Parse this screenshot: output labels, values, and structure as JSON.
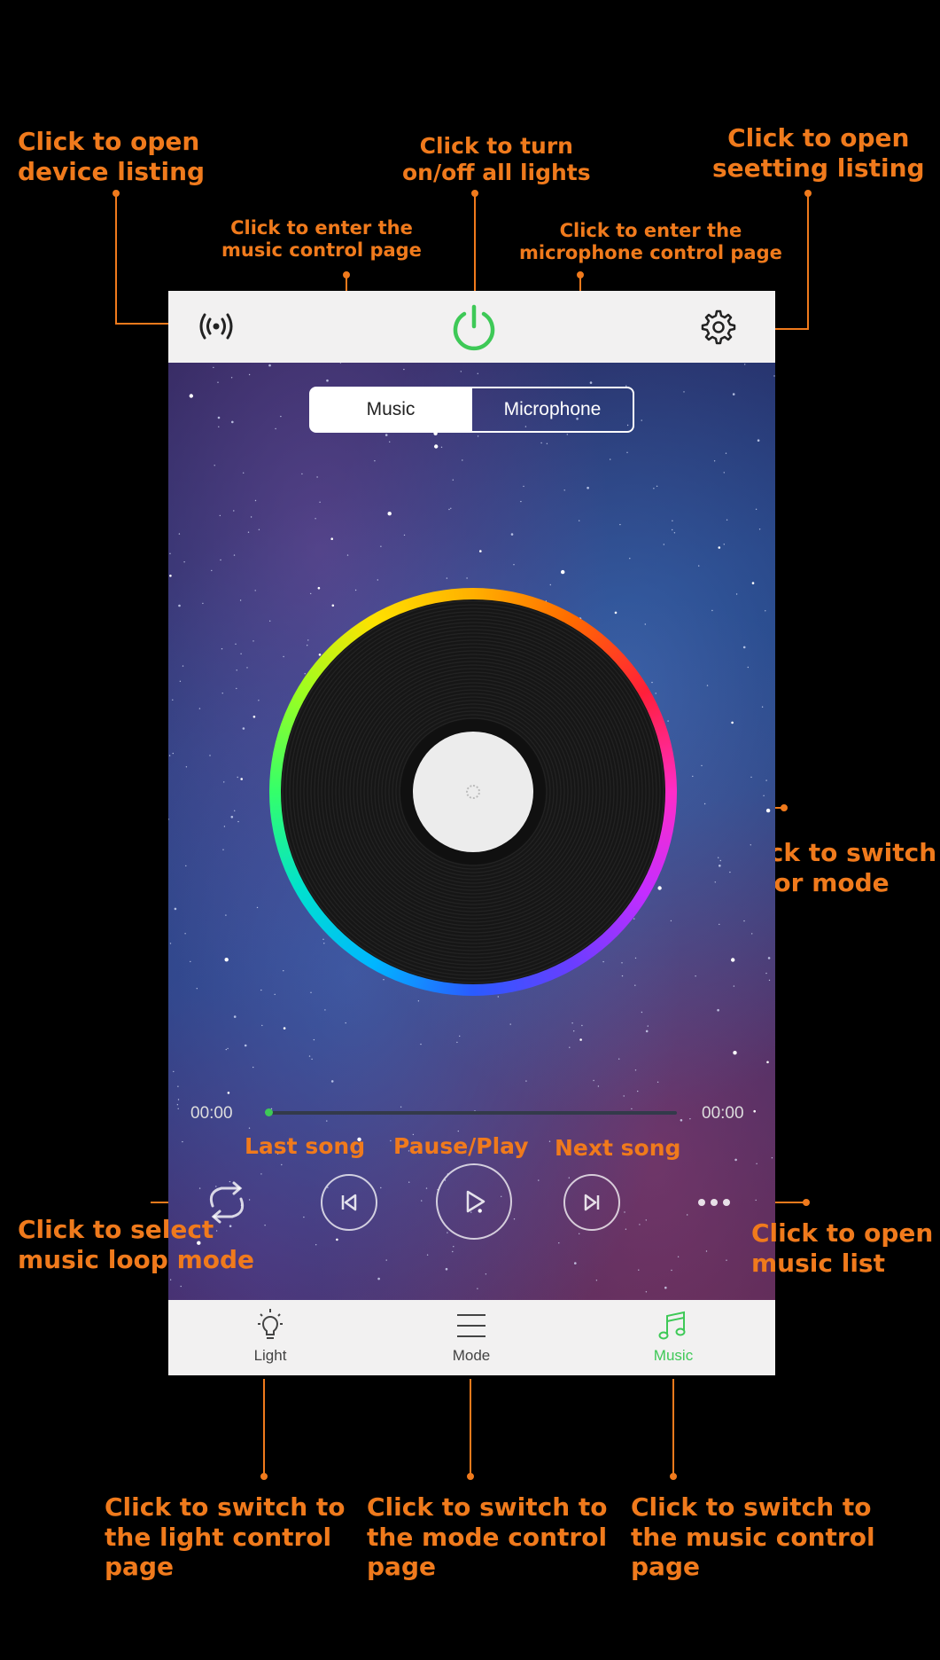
{
  "annotations": {
    "device_listing": "Click to open\ndevice listing",
    "power": "Click to turn\non/off all lights",
    "settings": "Click to open\nseetting listing",
    "music_page": "Click to enter the\nmusic control page",
    "mic_page": "Click to enter the\nmicrophone control page",
    "color_mode": "Click to switch\ncolor mode",
    "last_song": "Last song",
    "pause_play": "Pause/Play",
    "next_song": "Next song",
    "loop_mode": "Click to select\nmusic loop mode",
    "music_list": "Click to open\nmusic list",
    "light_tab": "Click to switch to\nthe light control\npage",
    "mode_tab": "Click to switch to\nthe mode control\npage",
    "music_tab": "Click to switch to\nthe music control\npage"
  },
  "segmented": {
    "music": "Music",
    "microphone": "Microphone",
    "selected": "Music"
  },
  "player": {
    "current_time": "00:00",
    "total_time": "00:00",
    "progress": 0.0,
    "state": "paused"
  },
  "tabs": [
    {
      "label": "Light",
      "icon": "bulb-icon",
      "active": false
    },
    {
      "label": "Mode",
      "icon": "menu-icon",
      "active": false
    },
    {
      "label": "Music",
      "icon": "music-note-icon",
      "active": true
    }
  ],
  "colors": {
    "accent": "#3ec957",
    "annotation": "#f07a1c",
    "bar": "#f2f1f1"
  }
}
